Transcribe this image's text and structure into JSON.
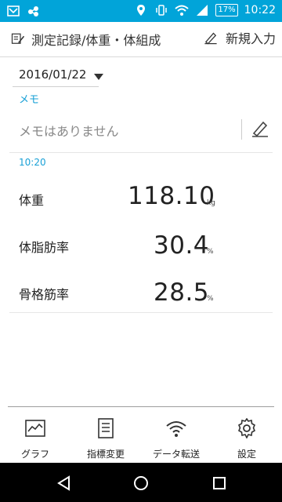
{
  "status_bar": {
    "time": "10:22",
    "battery_text": "17%",
    "icons": [
      "mail-icon",
      "cloud-sync-icon",
      "location-icon",
      "vibrate-icon",
      "wifi-icon",
      "signal-icon",
      "battery-icon"
    ]
  },
  "header": {
    "title": "測定記録/体重・体組成",
    "new_entry_label": "新規入力",
    "title_icon": "edit-note-icon",
    "new_entry_icon": "pen-icon"
  },
  "date": {
    "value": "2016/01/22"
  },
  "memo": {
    "label": "メモ",
    "text": "メモはありません",
    "edit_icon": "pen-icon"
  },
  "record": {
    "time": "10:20",
    "measurements": [
      {
        "name": "体重",
        "value": "118.10",
        "unit": "kg"
      },
      {
        "name": "体脂肪率",
        "value": "30.4",
        "unit": "%"
      },
      {
        "name": "骨格筋率",
        "value": "28.5",
        "unit": "%"
      }
    ]
  },
  "footer": {
    "items": [
      {
        "label": "グラフ",
        "icon": "graph-icon"
      },
      {
        "label": "指標変更",
        "icon": "document-icon"
      },
      {
        "label": "データ転送",
        "icon": "wireless-icon"
      },
      {
        "label": "設定",
        "icon": "settings-gear-icon"
      }
    ]
  },
  "system_nav": {
    "icons": [
      "back-icon",
      "home-icon",
      "recents-icon"
    ]
  }
}
